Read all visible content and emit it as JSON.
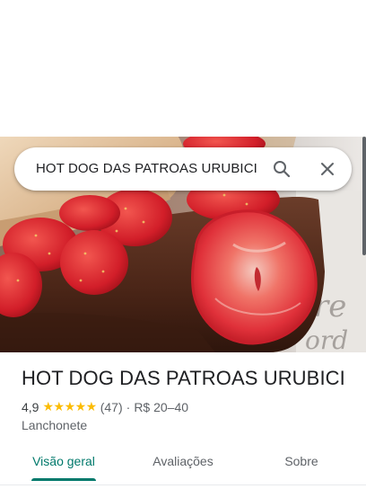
{
  "search": {
    "query": "HOT DOG DAS PATROAS URUBICI",
    "search_icon": "search-icon",
    "close_icon": "close-icon"
  },
  "hero": {
    "image": "photo-strawberries-chocolate"
  },
  "place": {
    "name": "HOT DOG DAS PATROAS URUBICI",
    "rating": "4,9",
    "stars": "★★★★★",
    "reviews": "(47)",
    "separator": "·",
    "price": "R$ 20–40",
    "category": "Lanchonete"
  },
  "tabs": [
    {
      "label": "Visão geral",
      "active": true
    },
    {
      "label": "Avaliações",
      "active": false
    },
    {
      "label": "Sobre",
      "active": false
    }
  ],
  "colors": {
    "accent": "#00796b",
    "star": "#fbbc04",
    "text_primary": "#202124",
    "text_secondary": "#5f6368"
  }
}
